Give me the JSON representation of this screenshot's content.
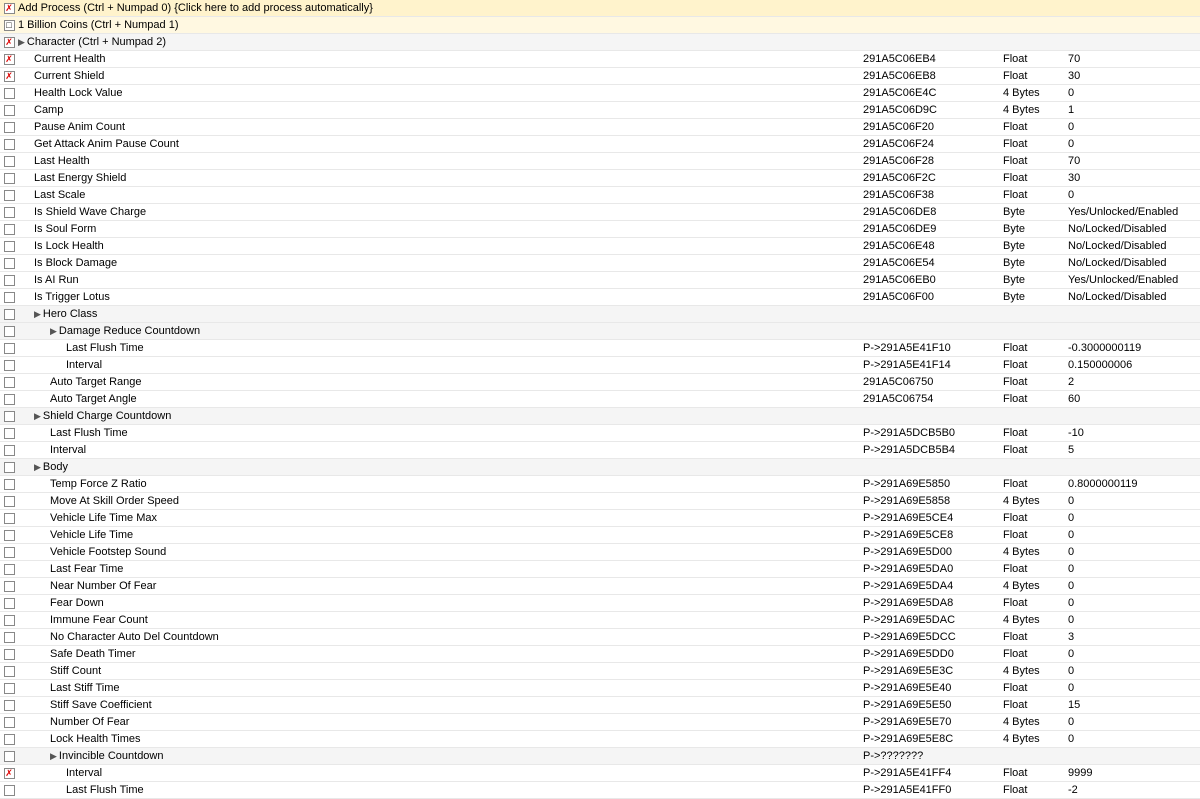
{
  "rows": [
    {
      "id": "add-process",
      "indent": 0,
      "checkType": "x",
      "name": "Add Process (Ctrl + Numpad 0) {Click here to add process automatically}",
      "address": "",
      "type": "",
      "value": "",
      "script": "<script>",
      "isGroup": false,
      "isHeader": true
    },
    {
      "id": "billion-coins",
      "indent": 0,
      "checkType": "square",
      "name": "1 Billion Coins (Ctrl + Numpad 1)",
      "address": "",
      "type": "",
      "value": "",
      "script": "<script>",
      "isGroup": false,
      "isHeader": true
    },
    {
      "id": "character-group",
      "indent": 0,
      "checkType": "x",
      "name": "Character (Ctrl + Numpad 2)",
      "address": "",
      "type": "",
      "value": "",
      "script": "<script>",
      "isGroup": true
    },
    {
      "id": "current-health",
      "indent": 1,
      "checkType": "x",
      "name": "Current Health",
      "address": "291A5C06EB4",
      "type": "Float",
      "value": "70",
      "script": "",
      "isGroup": false
    },
    {
      "id": "current-shield",
      "indent": 1,
      "checkType": "x",
      "name": "Current Shield",
      "address": "291A5C06EB8",
      "type": "Float",
      "value": "30",
      "script": "",
      "isGroup": false
    },
    {
      "id": "health-lock",
      "indent": 1,
      "checkType": "none",
      "name": "Health Lock Value",
      "address": "291A5C06E4C",
      "type": "4 Bytes",
      "value": "0",
      "script": "",
      "isGroup": false
    },
    {
      "id": "camp",
      "indent": 1,
      "checkType": "none",
      "name": "Camp",
      "address": "291A5C06D9C",
      "type": "4 Bytes",
      "value": "1",
      "script": "",
      "isGroup": false
    },
    {
      "id": "pause-anim",
      "indent": 1,
      "checkType": "none",
      "name": "Pause Anim Count",
      "address": "291A5C06F20",
      "type": "Float",
      "value": "0",
      "script": "",
      "isGroup": false
    },
    {
      "id": "get-attack",
      "indent": 1,
      "checkType": "none",
      "name": "Get Attack Anim Pause Count",
      "address": "291A5C06F24",
      "type": "Float",
      "value": "0",
      "script": "",
      "isGroup": false
    },
    {
      "id": "last-health",
      "indent": 1,
      "checkType": "none",
      "name": "Last Health",
      "address": "291A5C06F28",
      "type": "Float",
      "value": "70",
      "script": "",
      "isGroup": false
    },
    {
      "id": "last-energy",
      "indent": 1,
      "checkType": "none",
      "name": "Last Energy Shield",
      "address": "291A5C06F2C",
      "type": "Float",
      "value": "30",
      "script": "",
      "isGroup": false
    },
    {
      "id": "last-scale",
      "indent": 1,
      "checkType": "none",
      "name": "Last Scale",
      "address": "291A5C06F38",
      "type": "Float",
      "value": "0",
      "script": "",
      "isGroup": false
    },
    {
      "id": "is-shield-wave",
      "indent": 1,
      "checkType": "none",
      "name": "Is Shield Wave Charge",
      "address": "291A5C06DE8",
      "type": "Byte",
      "value": "Yes/Unlocked/Enabled",
      "script": "",
      "isGroup": false
    },
    {
      "id": "is-soul-form",
      "indent": 1,
      "checkType": "none",
      "name": "Is Soul Form",
      "address": "291A5C06DE9",
      "type": "Byte",
      "value": "No/Locked/Disabled",
      "script": "",
      "isGroup": false
    },
    {
      "id": "is-lock-health",
      "indent": 1,
      "checkType": "none",
      "name": "Is Lock Health",
      "address": "291A5C06E48",
      "type": "Byte",
      "value": "No/Locked/Disabled",
      "script": "",
      "isGroup": false
    },
    {
      "id": "is-block-damage",
      "indent": 1,
      "checkType": "none",
      "name": "Is Block Damage",
      "address": "291A5C06E54",
      "type": "Byte",
      "value": "No/Locked/Disabled",
      "script": "",
      "isGroup": false
    },
    {
      "id": "is-ai-run",
      "indent": 1,
      "checkType": "none",
      "name": "Is AI Run",
      "address": "291A5C06EB0",
      "type": "Byte",
      "value": "Yes/Unlocked/Enabled",
      "script": "",
      "isGroup": false
    },
    {
      "id": "is-trigger-lotus",
      "indent": 1,
      "checkType": "none",
      "name": "Is Trigger Lotus",
      "address": "291A5C06F00",
      "type": "Byte",
      "value": "No/Locked/Disabled",
      "script": "",
      "isGroup": false
    },
    {
      "id": "hero-class",
      "indent": 1,
      "checkType": "none",
      "name": "Hero Class",
      "address": "",
      "type": "",
      "value": "",
      "script": "",
      "isGroup": true
    },
    {
      "id": "damage-reduce",
      "indent": 2,
      "checkType": "none",
      "name": "Damage Reduce Countdown",
      "address": "",
      "type": "",
      "value": "",
      "script": "",
      "isGroup": true
    },
    {
      "id": "last-flush-1",
      "indent": 3,
      "checkType": "none",
      "name": "Last Flush Time",
      "address": "P->291A5E41F10",
      "type": "Float",
      "value": "-0.3000000119",
      "script": "",
      "isGroup": false
    },
    {
      "id": "interval-1",
      "indent": 3,
      "checkType": "none",
      "name": "Interval",
      "address": "P->291A5E41F14",
      "type": "Float",
      "value": "0.150000006",
      "script": "",
      "isGroup": false
    },
    {
      "id": "auto-target-range",
      "indent": 2,
      "checkType": "none",
      "name": "Auto Target Range",
      "address": "291A5C06750",
      "type": "Float",
      "value": "2",
      "script": "",
      "isGroup": false
    },
    {
      "id": "auto-target-angle",
      "indent": 2,
      "checkType": "none",
      "name": "Auto Target Angle",
      "address": "291A5C06754",
      "type": "Float",
      "value": "60",
      "script": "",
      "isGroup": false
    },
    {
      "id": "shield-charge-countdown",
      "indent": 1,
      "checkType": "none",
      "name": "Shield Charge Countdown",
      "address": "",
      "type": "",
      "value": "",
      "script": "",
      "isGroup": true
    },
    {
      "id": "last-flush-2",
      "indent": 2,
      "checkType": "none",
      "name": "Last Flush Time",
      "address": "P->291A5DCB5B0",
      "type": "Float",
      "value": "-10",
      "script": "",
      "isGroup": false
    },
    {
      "id": "interval-2",
      "indent": 2,
      "checkType": "none",
      "name": "Interval",
      "address": "P->291A5DCB5B4",
      "type": "Float",
      "value": "5",
      "script": "",
      "isGroup": false
    },
    {
      "id": "body-group",
      "indent": 1,
      "checkType": "none",
      "name": "Body",
      "address": "",
      "type": "",
      "value": "",
      "script": "",
      "isGroup": true
    },
    {
      "id": "temp-force",
      "indent": 2,
      "checkType": "none",
      "name": "Temp Force Z Ratio",
      "address": "P->291A69E5850",
      "type": "Float",
      "value": "0.8000000119",
      "script": "",
      "isGroup": false
    },
    {
      "id": "move-skill",
      "indent": 2,
      "checkType": "none",
      "name": "Move At Skill Order Speed",
      "address": "P->291A69E5858",
      "type": "4 Bytes",
      "value": "0",
      "script": "",
      "isGroup": false
    },
    {
      "id": "vehicle-life-max",
      "indent": 2,
      "checkType": "none",
      "name": "Vehicle Life Time Max",
      "address": "P->291A69E5CE4",
      "type": "Float",
      "value": "0",
      "script": "",
      "isGroup": false
    },
    {
      "id": "vehicle-life-time",
      "indent": 2,
      "checkType": "none",
      "name": "Vehicle Life Time",
      "address": "P->291A69E5CE8",
      "type": "Float",
      "value": "0",
      "script": "",
      "isGroup": false
    },
    {
      "id": "vehicle-footstep",
      "indent": 2,
      "checkType": "none",
      "name": "Vehicle Footstep Sound",
      "address": "P->291A69E5D00",
      "type": "4 Bytes",
      "value": "0",
      "script": "",
      "isGroup": false
    },
    {
      "id": "last-fear-time",
      "indent": 2,
      "checkType": "none",
      "name": "Last Fear Time",
      "address": "P->291A69E5DA0",
      "type": "Float",
      "value": "0",
      "script": "",
      "isGroup": false
    },
    {
      "id": "near-number-fear",
      "indent": 2,
      "checkType": "none",
      "name": "Near Number Of Fear",
      "address": "P->291A69E5DA4",
      "type": "4 Bytes",
      "value": "0",
      "script": "",
      "isGroup": false
    },
    {
      "id": "fear-down",
      "indent": 2,
      "checkType": "none",
      "name": "Fear Down",
      "address": "P->291A69E5DA8",
      "type": "Float",
      "value": "0",
      "script": "",
      "isGroup": false
    },
    {
      "id": "immune-fear",
      "indent": 2,
      "checkType": "none",
      "name": "Immune Fear Count",
      "address": "P->291A69E5DAC",
      "type": "4 Bytes",
      "value": "0",
      "script": "",
      "isGroup": false
    },
    {
      "id": "no-char-auto",
      "indent": 2,
      "checkType": "none",
      "name": "No Character Auto Del Countdown",
      "address": "P->291A69E5DCC",
      "type": "Float",
      "value": "3",
      "script": "",
      "isGroup": false
    },
    {
      "id": "safe-death",
      "indent": 2,
      "checkType": "none",
      "name": "Safe Death Timer",
      "address": "P->291A69E5DD0",
      "type": "Float",
      "value": "0",
      "script": "",
      "isGroup": false
    },
    {
      "id": "stiff-count",
      "indent": 2,
      "checkType": "none",
      "name": "Stiff Count",
      "address": "P->291A69E5E3C",
      "type": "4 Bytes",
      "value": "0",
      "script": "",
      "isGroup": false
    },
    {
      "id": "last-stiff",
      "indent": 2,
      "checkType": "none",
      "name": "Last Stiff Time",
      "address": "P->291A69E5E40",
      "type": "Float",
      "value": "0",
      "script": "",
      "isGroup": false
    },
    {
      "id": "stiff-save",
      "indent": 2,
      "checkType": "none",
      "name": "Stiff Save Coefficient",
      "address": "P->291A69E5E50",
      "type": "Float",
      "value": "15",
      "script": "",
      "isGroup": false
    },
    {
      "id": "number-fear",
      "indent": 2,
      "checkType": "none",
      "name": "Number Of Fear",
      "address": "P->291A69E5E70",
      "type": "4 Bytes",
      "value": "0",
      "script": "",
      "isGroup": false
    },
    {
      "id": "lock-health-times",
      "indent": 2,
      "checkType": "none",
      "name": "Lock Health Times",
      "address": "P->291A69E5E8C",
      "type": "4 Bytes",
      "value": "0",
      "script": "",
      "isGroup": false
    },
    {
      "id": "invincible-countdown",
      "indent": 2,
      "checkType": "none",
      "name": "Invincible Countdown",
      "address": "P->???????",
      "type": "",
      "value": "",
      "script": "",
      "isGroup": true
    },
    {
      "id": "interval-3",
      "indent": 3,
      "checkType": "x",
      "name": "Interval",
      "address": "P->291A5E41FF4",
      "type": "Float",
      "value": "9999",
      "script": "",
      "isGroup": false
    },
    {
      "id": "last-flush-3",
      "indent": 3,
      "checkType": "none",
      "name": "Last Flush Time",
      "address": "P->291A5E41FF0",
      "type": "Float",
      "value": "-2",
      "script": "",
      "isGroup": false
    }
  ]
}
